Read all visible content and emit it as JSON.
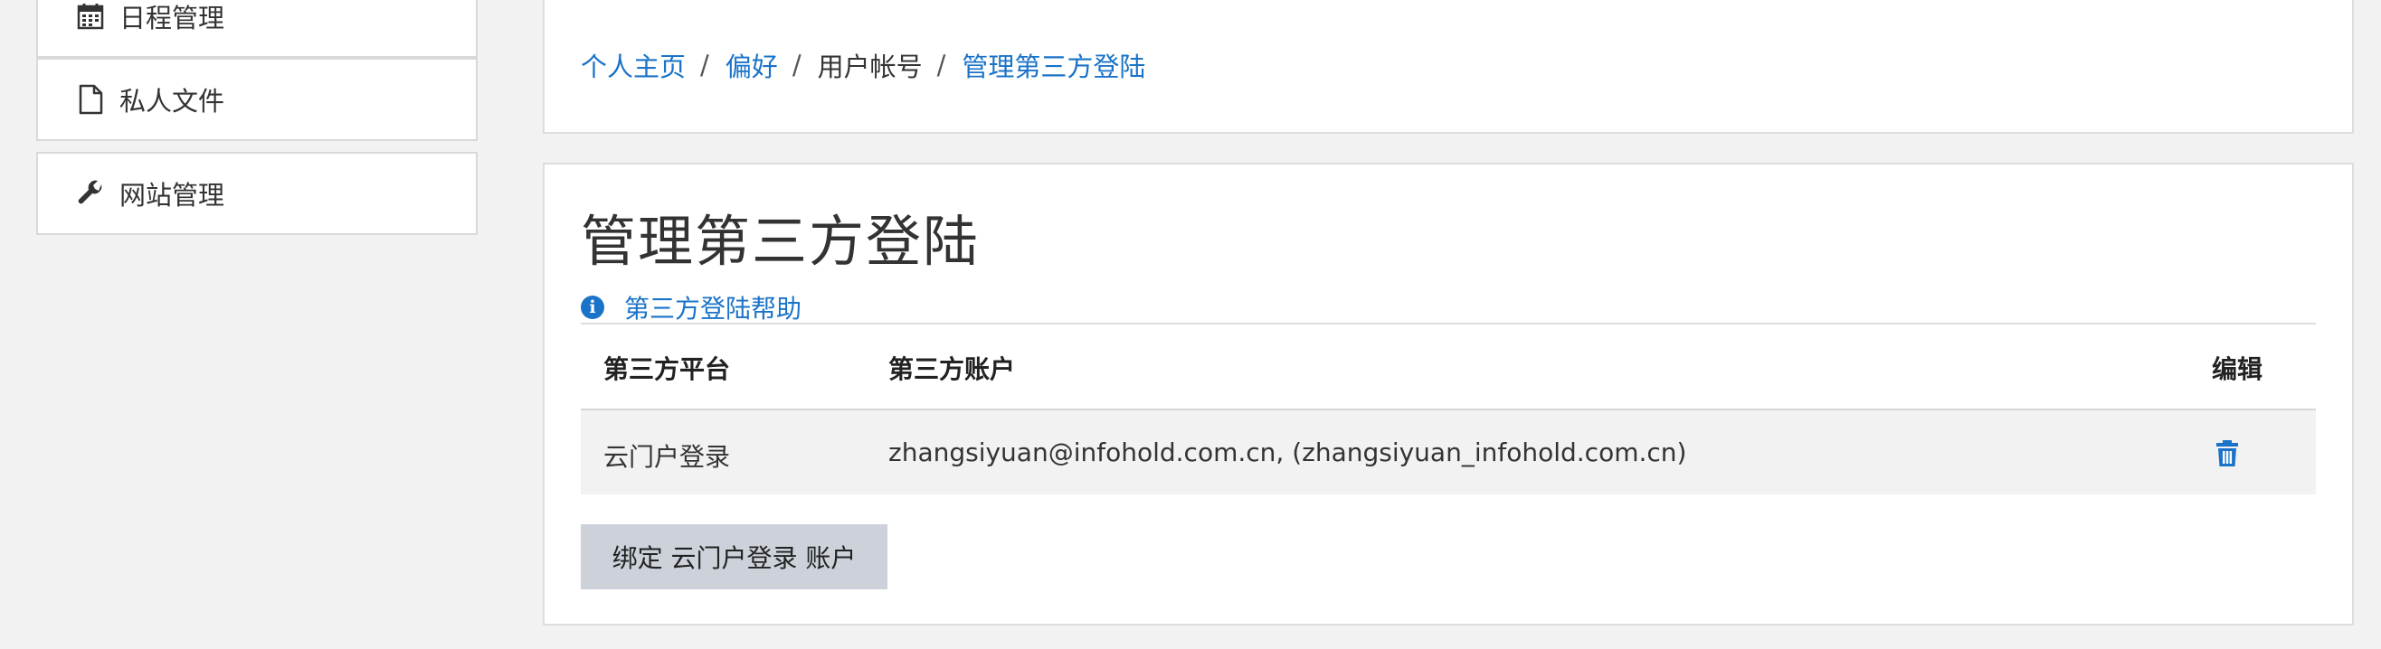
{
  "sidebar": {
    "items": [
      {
        "label": "日程管理",
        "icon": "calendar-icon"
      },
      {
        "label": "私人文件",
        "icon": "file-icon"
      },
      {
        "label": "网站管理",
        "icon": "wrench-icon"
      }
    ]
  },
  "breadcrumb": {
    "items": [
      {
        "label": "个人主页",
        "link": true
      },
      {
        "label": "偏好",
        "link": true
      },
      {
        "label": "用户帐号",
        "link": false
      },
      {
        "label": "管理第三方登陆",
        "link": true
      }
    ],
    "separator": "/"
  },
  "page": {
    "title": "管理第三方登陆",
    "help_label": "第三方登陆帮助",
    "help_icon": "info-icon"
  },
  "table": {
    "headers": [
      "第三方平台",
      "第三方账户",
      "编辑"
    ],
    "rows": [
      {
        "platform": "云门户登录",
        "account": "zhangsiyuan@infohold.com.cn, (zhangsiyuan_infohold.com.cn)",
        "action_icon": "trash-icon"
      }
    ]
  },
  "bind_button": {
    "label": "绑定 云门户登录 账户"
  },
  "colors": {
    "accent": "#1a73c8",
    "background": "#f2f2f2",
    "button_bg": "#cdd2da",
    "border": "#dddddd"
  }
}
